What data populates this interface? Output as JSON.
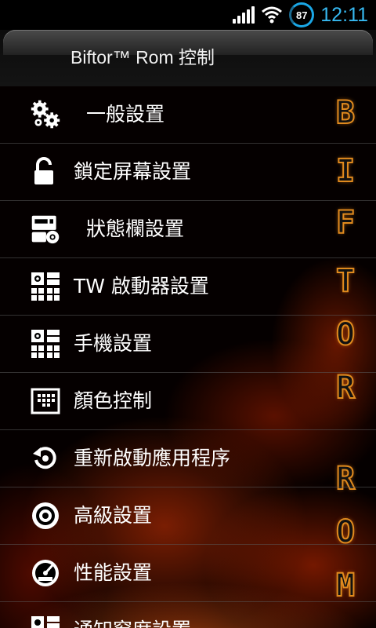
{
  "status_bar": {
    "battery_level": "87",
    "time": "12:11",
    "icons": [
      "signal-icon",
      "wifi-icon",
      "battery-icon"
    ]
  },
  "title_bar": {
    "title": "Biftor™ Rom 控制"
  },
  "menu": {
    "items": [
      {
        "label": "一般設置",
        "icon": "gears-icon"
      },
      {
        "label": "鎖定屏幕設置",
        "icon": "lock-icon"
      },
      {
        "label": "狀態欄設置",
        "icon": "statusbar-settings-icon"
      },
      {
        "label": "TW 啟動器設置",
        "icon": "launcher-grid-icon"
      },
      {
        "label": "手機設置",
        "icon": "phone-grid-icon"
      },
      {
        "label": "顏色控制",
        "icon": "color-palette-icon"
      },
      {
        "label": "重新啟動應用程序",
        "icon": "restart-icon"
      },
      {
        "label": "高級設置",
        "icon": "advanced-gear-icon"
      },
      {
        "label": "性能設置",
        "icon": "performance-gauge-icon"
      },
      {
        "label": "通知窗席設置",
        "icon": "notification-grid-icon"
      }
    ]
  },
  "brand_vertical": {
    "letters": [
      "B",
      "I",
      "F",
      "T",
      "O",
      "R",
      "R",
      "O",
      "M"
    ],
    "color": "#e08a1e"
  },
  "colors": {
    "accent": "#36b8f0",
    "background": "#000000"
  }
}
